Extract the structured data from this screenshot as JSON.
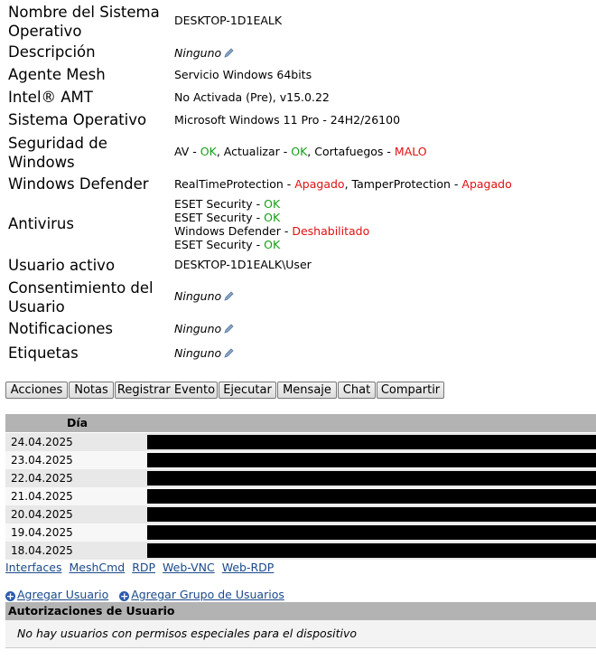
{
  "info": {
    "os_name": {
      "label": "Nombre del Sistema Operativo",
      "value": "DESKTOP-1D1EALK"
    },
    "description": {
      "label": "Descripción",
      "value": "Ninguno"
    },
    "mesh_agent": {
      "label": "Agente Mesh",
      "value": "Servicio Windows 64bits"
    },
    "intel_amt": {
      "label": "Intel® AMT",
      "value": "No Activada (Pre), v15.0.22"
    },
    "os": {
      "label": "Sistema Operativo",
      "value": "Microsoft Windows 11 Pro - 24H2/26100"
    },
    "security": {
      "label": "Seguridad de Windows",
      "av": "AV",
      "av_status": "OK",
      "update": "Actualizar",
      "update_status": "OK",
      "firewall": "Cortafuegos",
      "firewall_status": "MALO"
    },
    "defender": {
      "label": "Windows Defender",
      "realtime": "RealTimeProtection",
      "realtime_status": "Apagado",
      "tamper": "TamperProtection",
      "tamper_status": "Apagado"
    },
    "antivirus": {
      "label": "Antivirus",
      "items": [
        {
          "name": "ESET Security",
          "status": "OK"
        },
        {
          "name": "ESET Security",
          "status": "OK"
        },
        {
          "name": "Windows Defender",
          "status": "Deshabilitado"
        },
        {
          "name": "ESET Security",
          "status": "OK"
        }
      ]
    },
    "active_user": {
      "label": "Usuario activo",
      "value": "DESKTOP-1D1EALK\\User"
    },
    "consent": {
      "label": "Consentimiento del Usuario",
      "value": "Ninguno"
    },
    "notifications": {
      "label": "Notificaciones",
      "value": "Ninguno"
    },
    "tags": {
      "label": "Etiquetas",
      "value": "Ninguno"
    }
  },
  "buttons": [
    "Acciones",
    "Notas",
    "Registrar Evento",
    "Ejecutar",
    "Mensaje",
    "Chat",
    "Compartir"
  ],
  "events_table": {
    "header": "Día",
    "rows": [
      "24.04.2025",
      "23.04.2025",
      "22.04.2025",
      "21.04.2025",
      "20.04.2025",
      "19.04.2025",
      "18.04.2025"
    ]
  },
  "links": [
    "Interfaces",
    "MeshCmd",
    "RDP",
    "Web-VNC",
    "Web-RDP"
  ],
  "add_user": "Agregar Usuario",
  "add_group": "Agregar Grupo de Usuarios",
  "permissions": {
    "header": "Autorizaciones de Usuario",
    "empty": "No hay usuarios con permisos especiales para el dispositivo"
  },
  "colors": {
    "ok": "#16a016",
    "bad": "#e01010",
    "link": "#1a4a8a",
    "header_bg": "#b3b3b3"
  }
}
